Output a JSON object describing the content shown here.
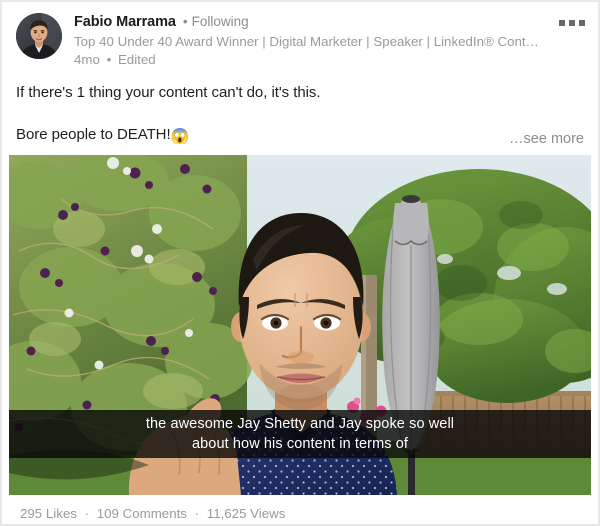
{
  "post": {
    "author": {
      "name": "Fabio Marrama",
      "following_separator": "•",
      "following_label": "Following",
      "headline": "Top 40 Under 40 Award Winner | Digital Marketer | Speaker | LinkedIn® Cont…",
      "registered_mark": "®",
      "avatar_alt": "avatar"
    },
    "meta": {
      "time_ago": "4mo",
      "separator": "•",
      "edited_label": "Edited"
    },
    "menu": {
      "label": "More options"
    },
    "content": {
      "line_1": "If there's 1 thing your content can't do, it's this.",
      "line_2": "Bore people to DEATH!",
      "emoji": "😱",
      "see_more": "…see more"
    },
    "video": {
      "caption_line_1": "the awesome Jay Shetty and Jay spoke so well",
      "caption_line_2": "about how his content in terms of"
    },
    "stats": {
      "likes": "295 Likes",
      "separator_1": "·",
      "comments": "109 Comments",
      "separator_2": "·",
      "views": "11,625 Views"
    }
  },
  "colors": {
    "card_border": "#e8e8e8",
    "text_primary": "#1f1f1f",
    "text_muted": "#9a9a9a",
    "caption_bg": "rgba(8,8,8,0.80)"
  }
}
